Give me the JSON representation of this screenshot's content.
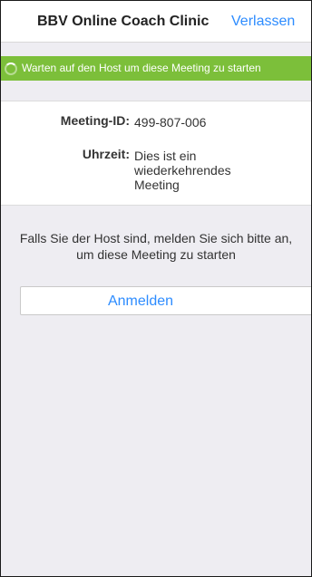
{
  "header": {
    "title": "BBV Online Coach Clinic",
    "leave_label": "Verlassen"
  },
  "status": {
    "message": "Warten auf den Host um diese Meeting zu starten",
    "color": "#7cbf3a",
    "icon": "spinner-icon"
  },
  "meeting": {
    "id_label": "Meeting-ID:",
    "id_value": "499-807-006",
    "time_label": "Uhrzeit:",
    "time_value": "Dies ist ein wiederkehrendes Meeting"
  },
  "host_prompt": {
    "line1": "Falls Sie der Host sind, melden Sie sich bitte an,",
    "line2": "um diese Meeting zu starten"
  },
  "login": {
    "button_label": "Anmelden",
    "accent": "#2d8cff"
  }
}
